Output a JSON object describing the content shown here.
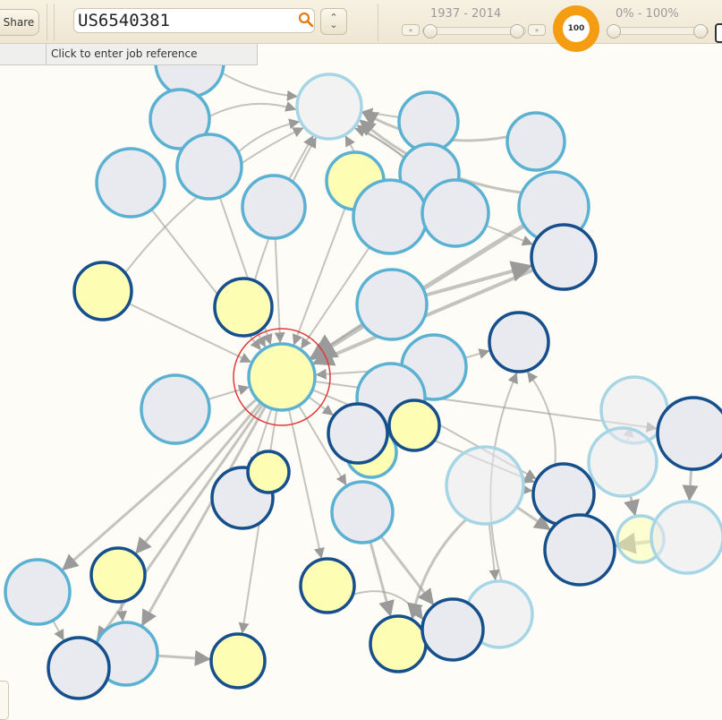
{
  "toolbar": {
    "share_label": "Share",
    "search_value": "US6540381",
    "search_icon": "search-icon",
    "updown_icon": "up-down-chevron-icon",
    "year_range_label": "1937 - 2014",
    "year_prev_icon": "double-chevron-left-icon",
    "year_next_icon": "double-chevron-right-icon",
    "gauge_value": "100",
    "gauge_color": "#f59d12",
    "percent_range_label": "0% - 100%"
  },
  "job_reference": {
    "label": "Click to enter job reference"
  },
  "graph": {
    "colors": {
      "yellow_fill": "#fdfeb4",
      "grey_fill": "#e9eaf0",
      "light_border": "#5bb1d2",
      "dark_border": "#154f8c",
      "faded_border": "#a6d6e6",
      "edge": "#9c9c9c",
      "focus_ring": "#e0393a"
    }
  }
}
